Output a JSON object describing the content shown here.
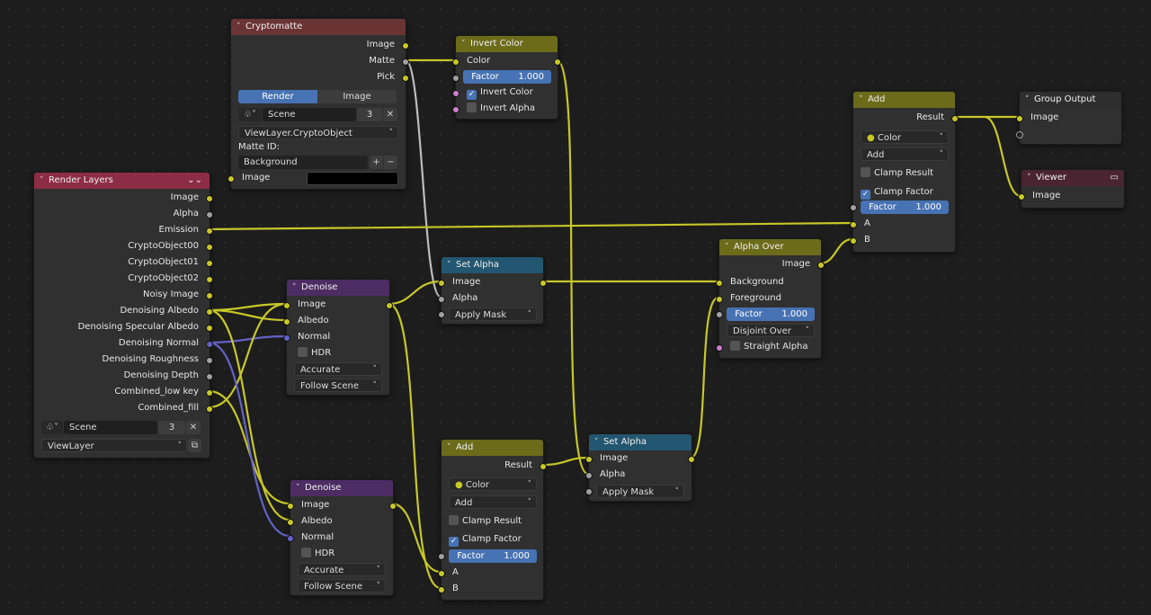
{
  "nodes": {
    "cryptomatte": {
      "title": "Cryptomatte",
      "outputs": [
        "Image",
        "Matte",
        "Pick"
      ],
      "tabs": [
        "Render",
        "Image"
      ],
      "scene": {
        "name": "Scene",
        "users": "3"
      },
      "layer": "ViewLayer.CryptoObject",
      "matte_id_label": "Matte ID:",
      "matte_id_value": "Background",
      "input_image": "Image"
    },
    "invert_color": {
      "title": "Invert Color",
      "output": "Color",
      "factor_label": "Factor",
      "factor_value": "1.000",
      "invert_color": "Invert Color",
      "invert_alpha": "Invert Alpha"
    },
    "render_layers": {
      "title": "Render Layers",
      "outputs": [
        "Image",
        "Alpha",
        "Emission",
        "CryptoObject00",
        "CryptoObject01",
        "CryptoObject02",
        "Noisy Image",
        "Denoising Albedo",
        "Denoising Specular Albedo",
        "Denoising Normal",
        "Denoising Roughness",
        "Denoising Depth",
        "Combined_low key",
        "Combined_fill"
      ],
      "scene": {
        "name": "Scene",
        "users": "3"
      },
      "layer": "ViewLayer"
    },
    "denoise_top": {
      "title": "Denoise",
      "inputs": [
        "Image",
        "Albedo",
        "Normal"
      ],
      "hdr": "HDR",
      "prefilter": "Accurate",
      "quality": "Follow Scene"
    },
    "denoise_bottom": {
      "title": "Denoise",
      "inputs": [
        "Image",
        "Albedo",
        "Normal"
      ],
      "hdr": "HDR",
      "prefilter": "Accurate",
      "quality": "Follow Scene"
    },
    "set_alpha_top": {
      "title": "Set Alpha",
      "output": "Image",
      "alpha": "Alpha",
      "mode": "Apply Mask"
    },
    "set_alpha_bottom": {
      "title": "Set Alpha",
      "output": "Image",
      "alpha": "Alpha",
      "mode": "Apply Mask"
    },
    "add_bottom": {
      "title": "Add",
      "output": "Result",
      "data_type": "Color",
      "blend": "Add",
      "clamp_result": "Clamp Result",
      "clamp_factor": "Clamp Factor",
      "factor_label": "Factor",
      "factor_value": "1.000",
      "inputs": [
        "A",
        "B"
      ]
    },
    "add_top": {
      "title": "Add",
      "output": "Result",
      "data_type": "Color",
      "blend": "Add",
      "clamp_result": "Clamp Result",
      "clamp_factor": "Clamp Factor",
      "factor_label": "Factor",
      "factor_value": "1.000",
      "inputs": [
        "A",
        "B"
      ]
    },
    "alpha_over": {
      "title": "Alpha Over",
      "output": "Image",
      "inputs": [
        "Background",
        "Foreground"
      ],
      "factor_label": "Factor",
      "factor_value": "1.000",
      "mode": "Disjoint Over",
      "straight_alpha": "Straight Alpha"
    },
    "group_output": {
      "title": "Group Output",
      "input": "Image"
    },
    "viewer": {
      "title": "Viewer",
      "input": "Image"
    }
  },
  "socket_colors": {
    "color": "#c7c729",
    "float": "#a1a1a1",
    "vector": "#6363c7",
    "boolean": "#cc7fcc"
  }
}
